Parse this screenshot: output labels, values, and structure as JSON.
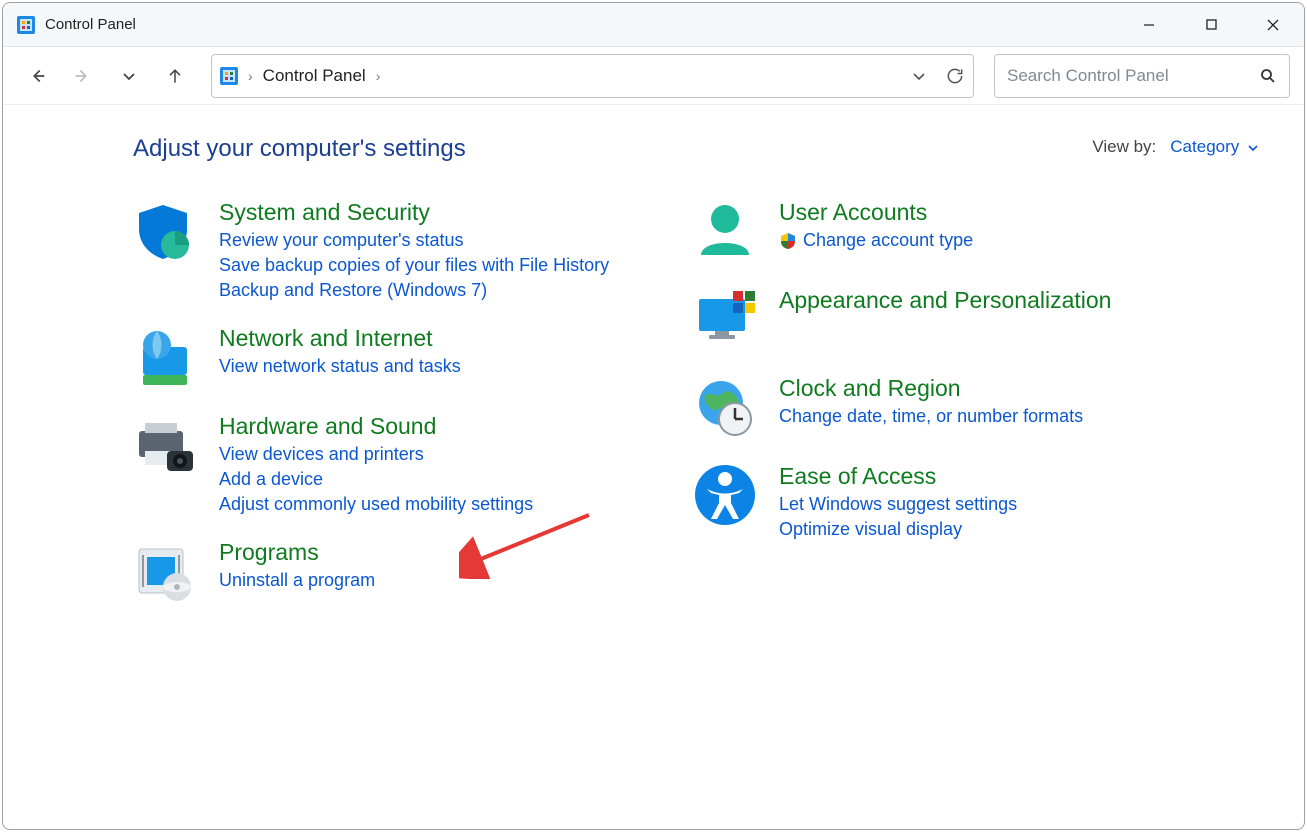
{
  "window": {
    "title": "Control Panel"
  },
  "address": {
    "crumb": "Control Panel"
  },
  "search": {
    "placeholder": "Search Control Panel"
  },
  "headline": "Adjust your computer's settings",
  "viewby": {
    "label": "View by:",
    "value": "Category"
  },
  "left": [
    {
      "title": "System and Security",
      "links": [
        "Review your computer's status",
        "Save backup copies of your files with File History",
        "Backup and Restore (Windows 7)"
      ]
    },
    {
      "title": "Network and Internet",
      "links": [
        "View network status and tasks"
      ]
    },
    {
      "title": "Hardware and Sound",
      "links": [
        "View devices and printers",
        "Add a device",
        "Adjust commonly used mobility settings"
      ]
    },
    {
      "title": "Programs",
      "links": [
        "Uninstall a program"
      ]
    }
  ],
  "right": [
    {
      "title": "User Accounts",
      "links": [
        "Change account type"
      ],
      "shield_on_first": true
    },
    {
      "title": "Appearance and Personalization",
      "links": []
    },
    {
      "title": "Clock and Region",
      "links": [
        "Change date, time, or number formats"
      ]
    },
    {
      "title": "Ease of Access",
      "links": [
        "Let Windows suggest settings",
        "Optimize visual display"
      ]
    }
  ]
}
